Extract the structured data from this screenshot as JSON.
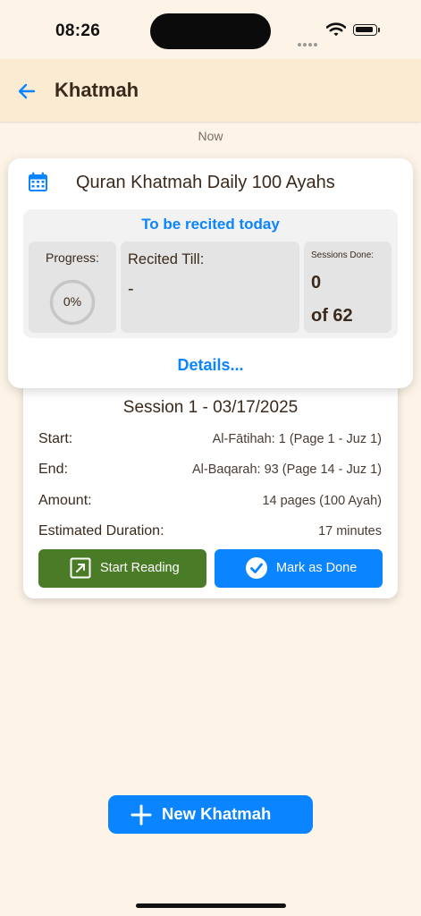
{
  "status_bar": {
    "time": "08:26"
  },
  "app_bar": {
    "title": "Khatmah",
    "back_icon": "arrow-left-icon"
  },
  "time_label": "Now",
  "khatmah": {
    "title": "Quran Khatmah Daily 100 Ayahs",
    "panel_heading": "To be recited today",
    "progress": {
      "label": "Progress:",
      "value": 0,
      "value_text": "0%"
    },
    "recited_till": {
      "label": "Recited Till:",
      "value": "-"
    },
    "sessions": {
      "label": "Sessions Done:",
      "done": "0",
      "total": "of 62"
    },
    "details_link": "Details..."
  },
  "session": {
    "title": "Session 1 - 03/17/2025",
    "rows": [
      {
        "label": "Start:",
        "value": "Al-Fātihah: 1 (Page 1 - Juz 1)"
      },
      {
        "label": "End:",
        "value": "Al-Baqarah: 93 (Page 14 - Juz 1)"
      },
      {
        "label": "Amount:",
        "value": "14 pages (100 Ayah)"
      },
      {
        "label": "Estimated Duration:",
        "value": "17 minutes"
      }
    ],
    "start_reading": "Start Reading",
    "mark_done": "Mark as Done"
  },
  "new_khatmah_button": "New Khatmah",
  "colors": {
    "accent": "#0a84ff",
    "green": "#4a7c28",
    "background": "#fdf4e7",
    "app_bar": "#fcebd3"
  }
}
